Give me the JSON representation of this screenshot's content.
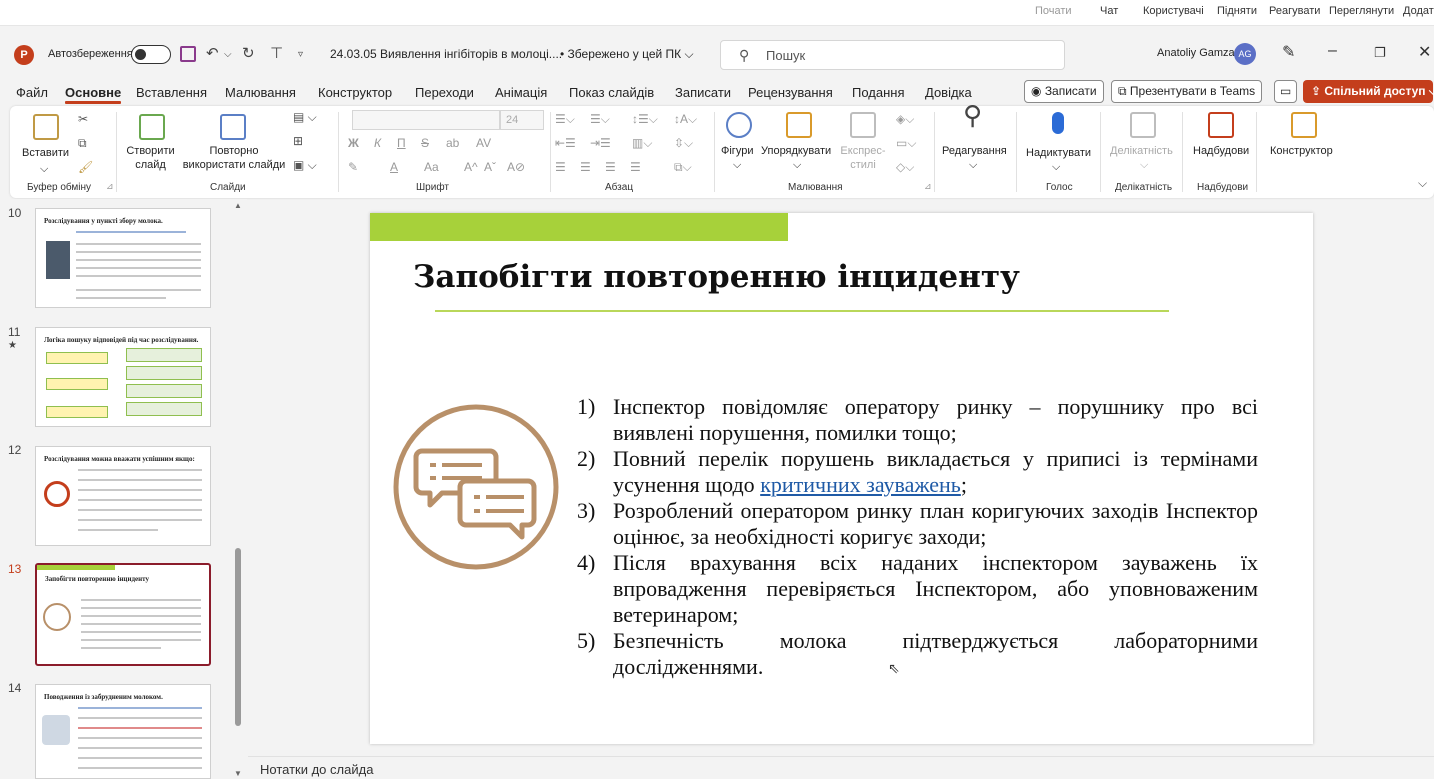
{
  "meeting_bar": {
    "items": [
      "Почати",
      "Чат",
      "Користувачі",
      "Підняти",
      "Реагувати",
      "Переглянути",
      "Додат"
    ]
  },
  "titlebar": {
    "logo": "P",
    "autosave_label": "Автозбереження",
    "doc_title": "24.03.05 Виявлення інгібіторів в молоці....",
    "saved_status": "• Збережено у цей ПК ⌵",
    "search_placeholder": "Пошук",
    "user_name": "Anatoliy Gamza",
    "user_initials": "AG"
  },
  "tabs": [
    "Файл",
    "Основне",
    "Вставлення",
    "Малювання",
    "Конструктор",
    "Переходи",
    "Анімація",
    "Показ слайдів",
    "Записати",
    "Рецензування",
    "Подання",
    "Довідка"
  ],
  "active_tab": "Основне",
  "right_buttons": {
    "record": "Записати",
    "present_teams": "Презентувати в Teams",
    "share": "Спільний доступ"
  },
  "ribbon": {
    "paste": "Вставити",
    "new_slide": "Створити слайд",
    "reuse_slides": "Повторно використати слайди",
    "font_size": "24",
    "shapes": "Фігури",
    "arrange": "Упорядкувати",
    "quick_styles": "Експрес-стилі",
    "editing": "Редагування",
    "dictate": "Надиктувати",
    "sensitivity": "Делікатність",
    "addins": "Надбудови",
    "designer": "Конструктор",
    "groups": {
      "clipboard": "Буфер обміну",
      "slides": "Слайди",
      "font": "Шрифт",
      "paragraph": "Абзац",
      "drawing": "Малювання",
      "voice": "Голос",
      "sensitivity": "Делікатність",
      "addins": "Надбудови"
    }
  },
  "thumbnails": [
    {
      "num": "10",
      "title": "Розслідування у пункті збору молока."
    },
    {
      "num": "11",
      "title": "Логіка пошуку відповідей під час розслідування."
    },
    {
      "num": "12",
      "title": "Розслідування можна вважати успішним якщо:"
    },
    {
      "num": "13",
      "title": "Запобігти повторенню інциденту"
    },
    {
      "num": "14",
      "title": "Поводження із забрудненим молоком."
    }
  ],
  "slide": {
    "title": "Запобігти повторенню інциденту",
    "items": [
      {
        "num": "1)",
        "text": "Інспектор повідомляє оператору ринку – порушнику про всі виявлені порушення, помилки тощо;"
      },
      {
        "num": "2)",
        "text_before": "Повний перелік порушень викладається у приписі із термінами усунення щодо ",
        "link": "критичних зауважень",
        "text_after": ";"
      },
      {
        "num": "3)",
        "text": "Розроблений оператором ринку план коригуючих заходів Інспектор оцінює, за необхідності коригує заходи;"
      },
      {
        "num": "4)",
        "text": "Після врахування всіх наданих інспектором зауважень їх впровадження перевіряється Інспектором, або уповноваженим ветеринаром;"
      },
      {
        "num": "5)",
        "text": "Безпечність молока підтверджується лабораторними дослідженнями."
      }
    ]
  },
  "notes_placeholder": "Нотатки до слайда",
  "colors": {
    "accent": "#c43e1c",
    "slide_green": "#a7d13a",
    "icon_brown": "#b89069",
    "link": "#1f5aa6"
  }
}
